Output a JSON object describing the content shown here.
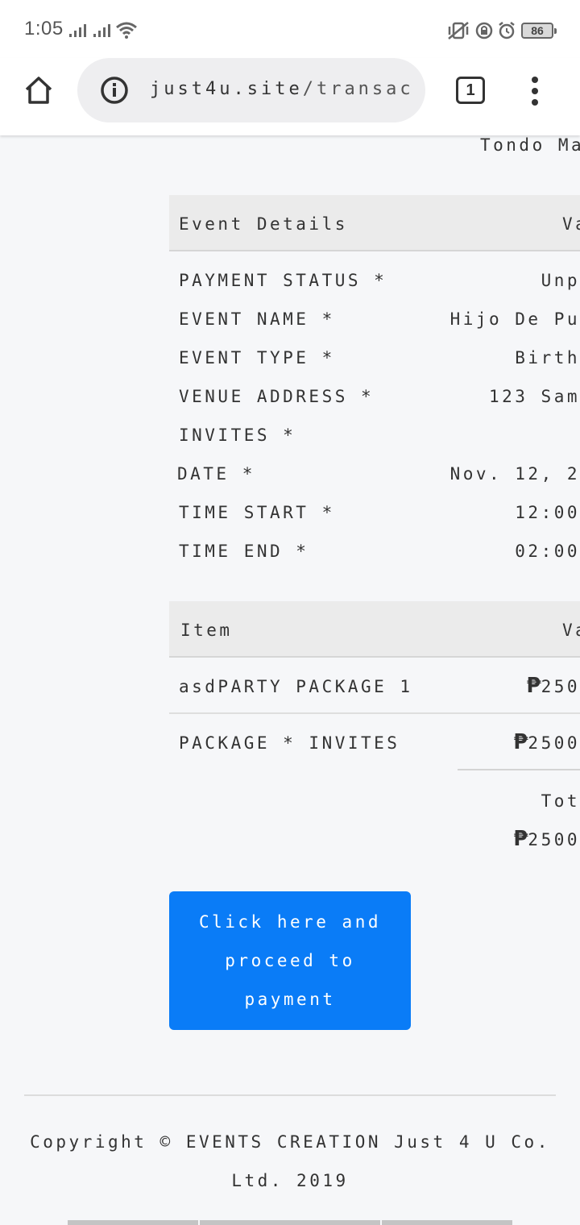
{
  "status_bar": {
    "time": "1:05",
    "battery": "86",
    "icons": [
      "signal-icon",
      "signal-icon",
      "wifi-icon",
      "vibrate-icon",
      "rotation-lock-icon",
      "alarm-icon",
      "battery-icon"
    ]
  },
  "browser": {
    "url_domain": "just4u.site",
    "url_path": "/transac.p",
    "tab_count": "1",
    "icons": [
      "home-icon",
      "info-icon",
      "tabs-icon",
      "menu-icon"
    ]
  },
  "page": {
    "top_partial_text": "Tondo Man",
    "event_table": {
      "header": [
        "Event Details",
        "Va"
      ],
      "rows": [
        {
          "label": "PAYMENT STATUS *",
          "value": "Unp"
        },
        {
          "label": "EVENT NAME *",
          "value": "Hijo De Pu"
        },
        {
          "label": "EVENT TYPE *",
          "value": "Birth"
        },
        {
          "label": "VENUE ADDRESS *",
          "value": "123 Sam"
        },
        {
          "label": "INVITES *",
          "value": ""
        },
        {
          "label": "DATE *",
          "value": "Nov. 12, 2"
        },
        {
          "label": "TIME START *",
          "value": "12:00"
        },
        {
          "label": "TIME END *",
          "value": "02:00"
        }
      ]
    },
    "item_table": {
      "header": [
        "Item",
        "Va"
      ],
      "rows": [
        {
          "label": "asdPARTY PACKAGE 1",
          "currency": "₱",
          "value": "250"
        },
        {
          "label": "PACKAGE * INVITES",
          "currency": "₱",
          "value": "2500"
        }
      ],
      "total_label": "Tot",
      "total_currency": "₱",
      "total_value": "2500"
    },
    "pay_button_label": "Click here and proceed to payment",
    "footer": "Copyright © EVENTS CREATION Just 4 U Co. Ltd. 2019"
  },
  "colors": {
    "button": "#0a7cf7",
    "background": "#f6f7f9",
    "table_header": "#ebebeb"
  }
}
